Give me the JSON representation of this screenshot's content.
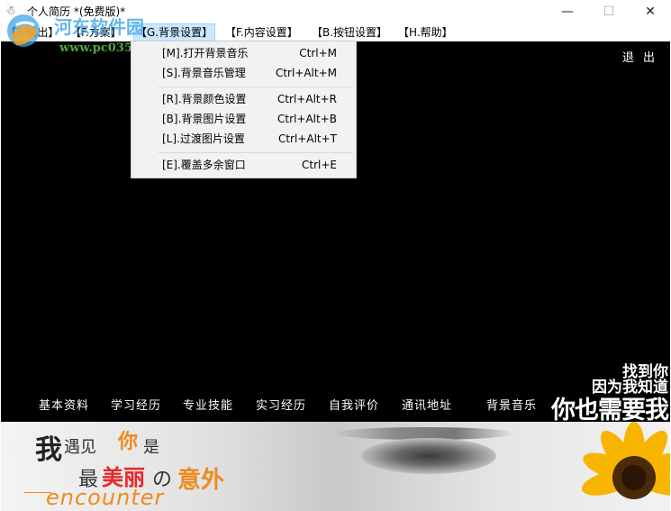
{
  "window": {
    "title": "个人简历 *(免费版)*",
    "minimize": "—",
    "maximize": "☐",
    "close": "✕"
  },
  "watermark": {
    "site": "河东软件园",
    "url": "www.pc0359.cn"
  },
  "menu": [
    {
      "label": "【S.输出】"
    },
    {
      "label": "【F.方案】"
    },
    {
      "label": "【G.背景设置】"
    },
    {
      "label": "【F.内容设置】"
    },
    {
      "label": "【B.按钮设置】"
    },
    {
      "label": "【H.帮助】"
    }
  ],
  "dropdown": {
    "groups": [
      [
        {
          "label": "[M].打开背景音乐",
          "shortcut": "Ctrl+M"
        },
        {
          "label": "[S].背景音乐管理",
          "shortcut": "Ctrl+Alt+M"
        }
      ],
      [
        {
          "label": "[R].背景颜色设置",
          "shortcut": "Ctrl+Alt+R"
        },
        {
          "label": "[B].背景图片设置",
          "shortcut": "Ctrl+Alt+B"
        },
        {
          "label": "[L].过渡图片设置",
          "shortcut": "Ctrl+Alt+T"
        }
      ],
      [
        {
          "label": "[E].覆盖多余窗口",
          "shortcut": "Ctrl+E"
        }
      ]
    ]
  },
  "content": {
    "exit": "退 出",
    "nav": [
      "基本资料",
      "学习经历",
      "专业技能",
      "实习经历",
      "自我评价",
      "通讯地址",
      "背景音乐"
    ],
    "slogan": [
      "找到你",
      "因为我知道",
      "你也需要我"
    ]
  },
  "banner": {
    "wo": "我",
    "yujian": "遇见",
    "ni": "你",
    "shi": "是",
    "zui": "最",
    "meili": "美丽",
    "de": "の",
    "yiwai": "意外",
    "english": "encounter"
  },
  "colors": {
    "background": "#000000",
    "menu_highlight": "#cce8ff",
    "accent_orange": "#f08a1c",
    "accent_red": "#e8272a"
  }
}
